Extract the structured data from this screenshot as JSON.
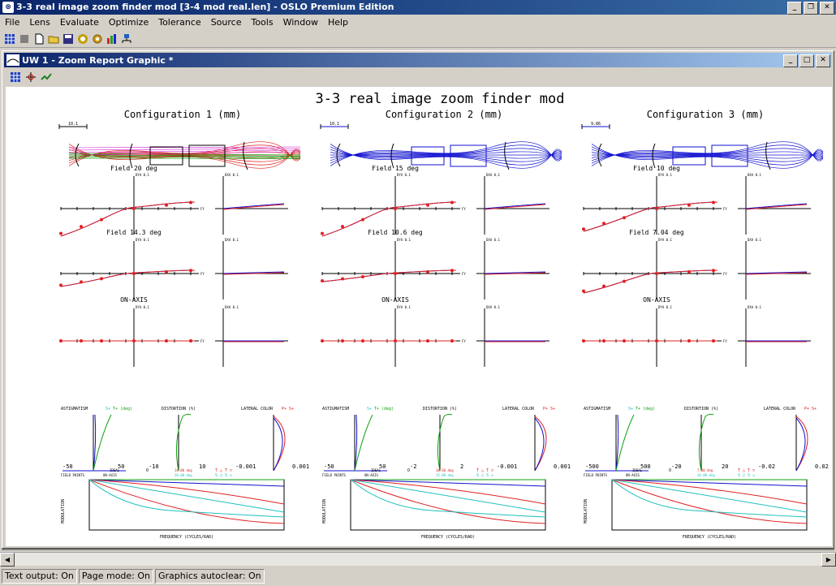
{
  "window": {
    "title": "3-3 real image zoom finder mod [3-4 mod real.len] - OSLO Premium Edition"
  },
  "menu": [
    "File",
    "Lens",
    "Evaluate",
    "Optimize",
    "Tolerance",
    "Source",
    "Tools",
    "Window",
    "Help"
  ],
  "toolbar_icons": [
    "grid-icon",
    "stop-icon",
    "new-file-icon",
    "open-folder-icon",
    "save-icon",
    "lens-icon",
    "gear-icon",
    "chart-icon",
    "network-icon"
  ],
  "child_window": {
    "title": "UW 1 - Zoom Report Graphic *"
  },
  "report": {
    "title": "3-3 real image zoom finder mod",
    "configs": [
      {
        "label": "Configuration 1 (mm)",
        "scale": "10.1",
        "fields": [
          "Field 20 deg",
          "Field 14.3 deg",
          "ON-AXIS"
        ],
        "astig_range": [
          "-50",
          "50"
        ],
        "dist_range": [
          "-10",
          "10"
        ],
        "lat_range": [
          "-0.001",
          "0.001"
        ],
        "mtf_fields": [
          "14.00 deg",
          "20.00 deg"
        ]
      },
      {
        "label": "Configuration 2 (mm)",
        "scale": "10.1",
        "fields": [
          "Field 15 deg",
          "Field 10.6 deg",
          "ON-AXIS"
        ],
        "astig_range": [
          "-50",
          "50"
        ],
        "dist_range": [
          "-2",
          "2"
        ],
        "lat_range": [
          "-0.001",
          "0.001"
        ],
        "mtf_fields": [
          "10.60 deg",
          "15.00 deg"
        ]
      },
      {
        "label": "Configuration 3 (mm)",
        "scale": "9.86",
        "fields": [
          "Field 10 deg",
          "Field 7.04 deg",
          "ON-AXIS"
        ],
        "astig_range": [
          "-500",
          "500"
        ],
        "dist_range": [
          "-20",
          "20"
        ],
        "lat_range": [
          "-0.02",
          "0.02"
        ],
        "mtf_fields": [
          "7.00 deg",
          "10.00 deg"
        ]
      }
    ],
    "labels": {
      "astigmatism": "ASTIGMATISM",
      "s_plus": "S+",
      "t_plus": "T+",
      "deg": "(deg)",
      "distortion": "DISTORTION (%)",
      "lateral": "LATERAL COLOR",
      "p_plus": "P+",
      "field_points": "FIELD POINTS",
      "ideal": "IDEAL",
      "on_axis_short": "ON-AXIS",
      "modulation": "MODULATION",
      "frequency": "FREQUENCY (CYCLES/RAD)",
      "dya": "DYA",
      "dxa": "DXA",
      "ey_scale": "0.1",
      "fy": "FY",
      "t_lbl": "T",
      "s_lbl": "S"
    }
  },
  "status": [
    "Text output: On",
    "Page mode: On",
    "Graphics autoclear: On"
  ],
  "colors": {
    "title_blue": "#0a246a",
    "ray_red": "#e02020",
    "ray_blue": "#1010d0",
    "green": "#10a010",
    "cyan": "#20c0c0",
    "magenta": "#d020d0"
  }
}
